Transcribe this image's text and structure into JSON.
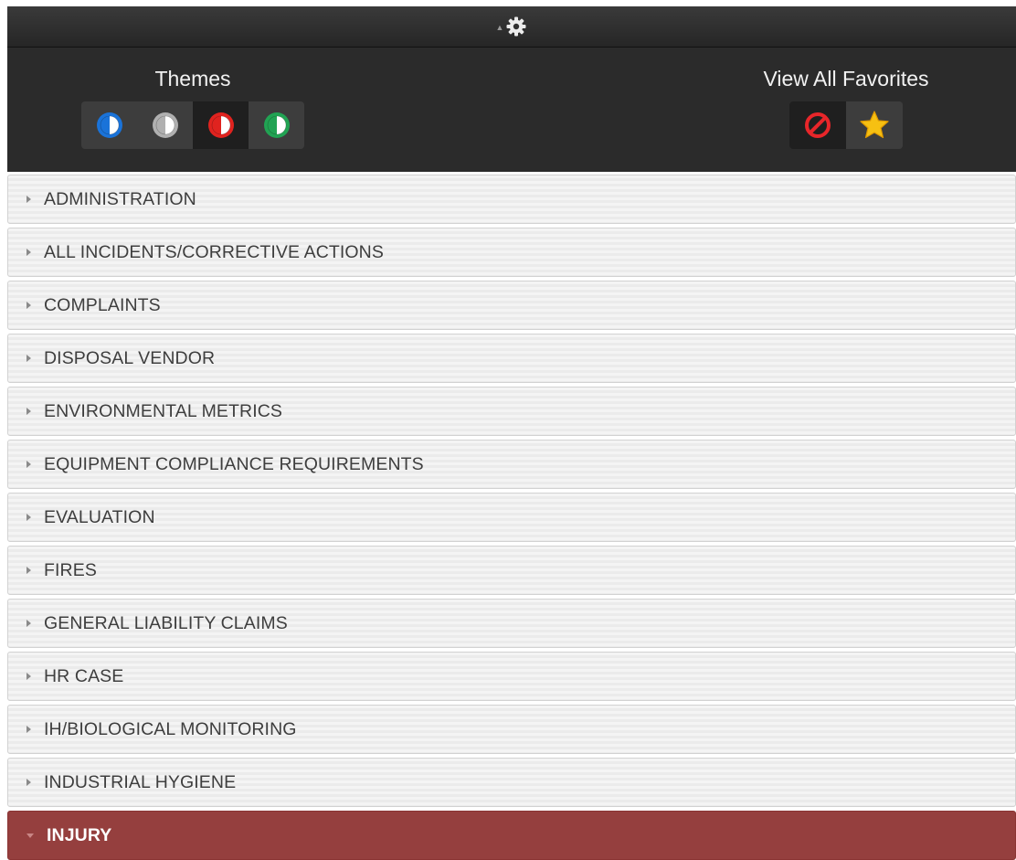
{
  "settings": {
    "themes_title": "Themes",
    "favorites_title": "View All Favorites",
    "theme_buttons": [
      {
        "name": "theme-blue-icon",
        "color": "#1a73d9",
        "active": false
      },
      {
        "name": "theme-gray-icon",
        "color": "#b0b0b0",
        "active": false
      },
      {
        "name": "theme-red-icon",
        "color": "#e0231f",
        "active": true
      },
      {
        "name": "theme-green-icon",
        "color": "#21a353",
        "active": false
      }
    ],
    "favorite_buttons": [
      {
        "name": "clear-favorites-icon",
        "color": "#e8262a"
      },
      {
        "name": "star-icon",
        "color": "#f6c012"
      }
    ]
  },
  "menu": {
    "items": [
      {
        "label": "ADMINISTRATION",
        "open": false
      },
      {
        "label": "ALL INCIDENTS/CORRECTIVE ACTIONS",
        "open": false
      },
      {
        "label": "COMPLAINTS",
        "open": false
      },
      {
        "label": "DISPOSAL VENDOR",
        "open": false
      },
      {
        "label": "ENVIRONMENTAL METRICS",
        "open": false
      },
      {
        "label": "EQUIPMENT COMPLIANCE REQUIREMENTS",
        "open": false
      },
      {
        "label": "EVALUATION",
        "open": false
      },
      {
        "label": "FIRES",
        "open": false
      },
      {
        "label": "GENERAL LIABILITY CLAIMS",
        "open": false
      },
      {
        "label": "HR CASE",
        "open": false
      },
      {
        "label": "IH/BIOLOGICAL MONITORING",
        "open": false
      },
      {
        "label": "INDUSTRIAL HYGIENE",
        "open": false
      },
      {
        "label": "INJURY",
        "open": true
      }
    ]
  },
  "colors": {
    "accent_open_row": "#953f3e",
    "header_dark": "#2b2b2b"
  }
}
